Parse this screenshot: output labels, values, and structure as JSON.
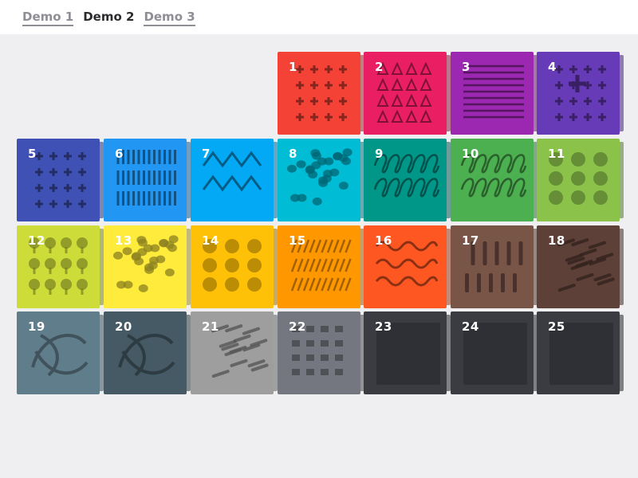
{
  "nav": {
    "items": [
      {
        "label": "Demo 1",
        "active": false
      },
      {
        "label": "Demo 2",
        "active": true
      },
      {
        "label": "Demo 3",
        "active": false
      }
    ]
  },
  "tiles": [
    {
      "num": "1",
      "color": "#f44336",
      "pattern": "plus-pattern"
    },
    {
      "num": "2",
      "color": "#e91e63",
      "pattern": "triangle-pattern"
    },
    {
      "num": "3",
      "color": "#9c27b0",
      "pattern": "line-pattern"
    },
    {
      "num": "4",
      "color": "#673ab7",
      "pattern": "plus-mixed-pattern"
    },
    {
      "num": "5",
      "color": "#3f51b5",
      "pattern": "plus-pattern"
    },
    {
      "num": "6",
      "color": "#2196f3",
      "pattern": "tick-pattern"
    },
    {
      "num": "7",
      "color": "#03a9f4",
      "pattern": "zigzag-pattern"
    },
    {
      "num": "8",
      "color": "#00bcd4",
      "pattern": "blob-pattern"
    },
    {
      "num": "9",
      "color": "#009688",
      "pattern": "loop-pattern"
    },
    {
      "num": "10",
      "color": "#4caf50",
      "pattern": "loop-pattern"
    },
    {
      "num": "11",
      "color": "#8bc34a",
      "pattern": "blot-pattern"
    },
    {
      "num": "12",
      "color": "#cddc39",
      "pattern": "tree-pattern"
    },
    {
      "num": "13",
      "color": "#ffeb3b",
      "pattern": "cell-pattern"
    },
    {
      "num": "14",
      "color": "#ffc107",
      "pattern": "splash-pattern"
    },
    {
      "num": "15",
      "color": "#ff9800",
      "pattern": "stroke-pattern"
    },
    {
      "num": "16",
      "color": "#ff5722",
      "pattern": "wave-pattern"
    },
    {
      "num": "17",
      "color": "#795548",
      "pattern": "brush-pattern"
    },
    {
      "num": "18",
      "color": "#5d4037",
      "pattern": "dash-pattern"
    },
    {
      "num": "19",
      "color": "#607d8b",
      "pattern": "swirl-pattern"
    },
    {
      "num": "20",
      "color": "#455a64",
      "pattern": "curve-pattern"
    },
    {
      "num": "21",
      "color": "#9e9e9e",
      "pattern": "smear-pattern"
    },
    {
      "num": "22",
      "color": "#757780",
      "pattern": "grunge-pattern"
    },
    {
      "num": "23",
      "color": "#3b3c42",
      "pattern": "empty"
    },
    {
      "num": "24",
      "color": "#3b3c42",
      "pattern": "empty"
    },
    {
      "num": "25",
      "color": "#3b3c42",
      "pattern": "empty"
    }
  ]
}
